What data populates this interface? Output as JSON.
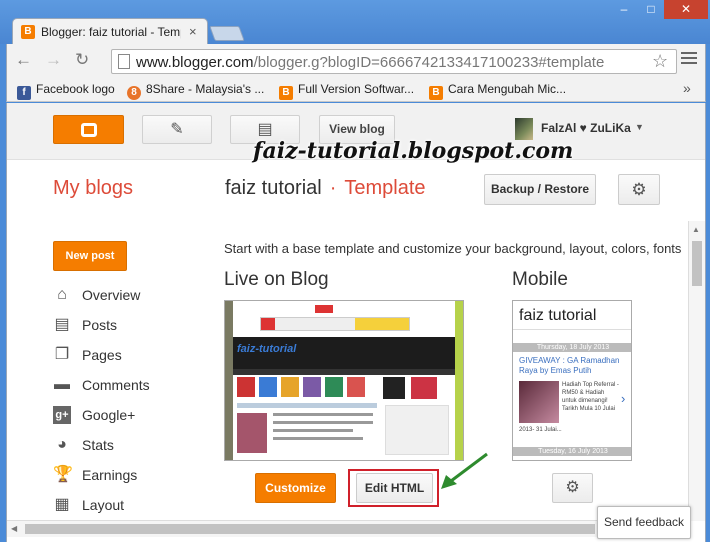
{
  "browser": {
    "tab_title": "Blogger: faiz tutorial - Template",
    "url_host": "www.blogger.com",
    "url_path": "/blogger.g?blogID=6666742133417100233#template",
    "bookmarks": [
      {
        "label": "Facebook logo",
        "icon": "facebook-icon",
        "color": "#3b5998"
      },
      {
        "label": "8Share - Malaysia's ...",
        "icon": "8share-icon",
        "color": "#e8742a"
      },
      {
        "label": "Full Version Softwar...",
        "icon": "blogger-icon",
        "color": "#f57d00"
      },
      {
        "label": "Cara Mengubah Mic...",
        "icon": "blogger-icon",
        "color": "#f57d00"
      }
    ]
  },
  "header": {
    "view_blog": "View blog",
    "user_name": "FalzAl ♥ ZuLiKa",
    "watermark": "faiz-tutorial.blogspot.com"
  },
  "page": {
    "my_blogs": "My blogs",
    "blog_name": "faiz tutorial",
    "separator": "·",
    "section": "Template",
    "backup_restore": "Backup / Restore"
  },
  "sidebar": {
    "new_post": "New post",
    "items": [
      {
        "label": "Overview",
        "icon": "home-icon"
      },
      {
        "label": "Posts",
        "icon": "posts-icon"
      },
      {
        "label": "Pages",
        "icon": "pages-icon"
      },
      {
        "label": "Comments",
        "icon": "comments-icon"
      },
      {
        "label": "Google+",
        "icon": "google-plus-icon"
      },
      {
        "label": "Stats",
        "icon": "stats-icon"
      },
      {
        "label": "Earnings",
        "icon": "trophy-icon"
      },
      {
        "label": "Layout",
        "icon": "layout-icon"
      }
    ]
  },
  "main": {
    "intro": "Start with a base template and customize your background, layout, colors, fonts",
    "live_label": "Live on Blog",
    "mobile_label": "Mobile",
    "customize": "Customize",
    "edit_html": "Edit HTML"
  },
  "mobile_preview": {
    "title": "faiz tutorial",
    "date1": "Thursday, 18 July 2013",
    "post_title": "GIVEAWAY : GA Ramadhan Raya by Emas Putih",
    "post_body": "Hadiah Top Referral - RM50 & Hadiah untuk dimenangi! Tarikh Mula 10 Julai",
    "post_date": "2013- 31 Julai...",
    "date2": "Tuesday, 16 July 2013"
  },
  "live_preview": {
    "blog_title": "faiz-tutorial"
  },
  "feedback": "Send feedback",
  "colors": {
    "accent": "#f57d00",
    "highlight": "#d0202a",
    "arrow": "#2e8b2e",
    "title_red": "#dd4b39"
  }
}
